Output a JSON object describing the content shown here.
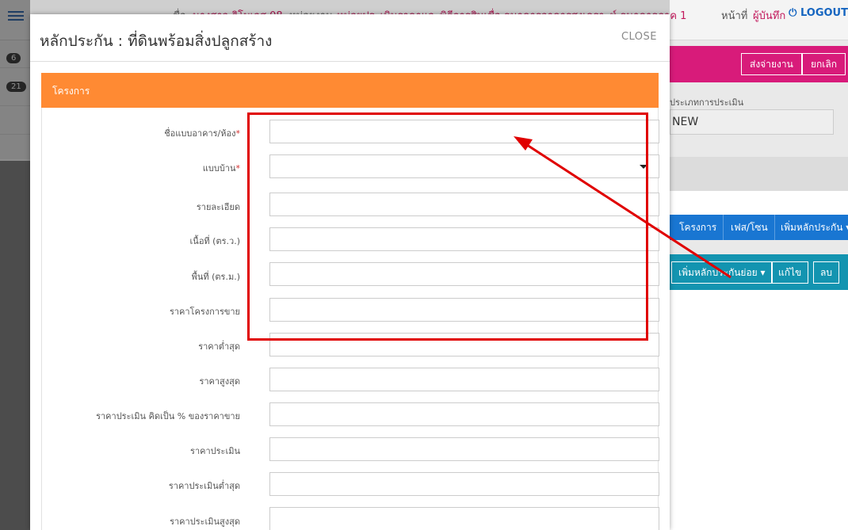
{
  "topbar": {
    "label_name": "ชื่อ",
    "user_name": "นางสาว ธิโมเลส 08",
    "label_unit": "หน่วยงาน",
    "unit_name": "หน่วยประเมินราคาและพิธีการสินเชื่อ ธนาคารอาคารสงเคราะห์ ธนาคารภาค 1",
    "label_page": "หน้าที่",
    "page_name": "ผู้บันทึก",
    "logout": "LOGOUT"
  },
  "sidebar": {
    "badges": [
      "6",
      "21"
    ]
  },
  "background_page": {
    "send_button": "ส่งจ่ายงาน",
    "cancel_button": "ยกเลิก",
    "eval_label": "ประเภทการประเมิน",
    "eval_value": "NEW",
    "tabs": [
      "โครงการ",
      "เฟส/โซน",
      "เพิ่มหลักประกัน"
    ],
    "add_sub_button": "เพิ่มหลักประกันย่อย",
    "edit_button": "แก้ไข",
    "delete_button": "ลบ"
  },
  "modal": {
    "title": "หลักประกัน : ที่ดินพร้อมสิ่งปลูกสร้าง",
    "close_label": "CLOSE",
    "section_title": "โครงการ",
    "fields": [
      {
        "label": "ชื่อแบบอาคาร/ห้อง",
        "required": true,
        "type": "text",
        "value": ""
      },
      {
        "label": "แบบบ้าน",
        "required": true,
        "type": "select",
        "value": ""
      },
      {
        "label": "รายละเอียด",
        "required": false,
        "type": "text",
        "value": ""
      },
      {
        "label": "เนื้อที่ (ตร.ว.)",
        "required": false,
        "type": "text",
        "value": ""
      },
      {
        "label": "พื้นที่ (ตร.ม.)",
        "required": false,
        "type": "text",
        "value": ""
      },
      {
        "label": "ราคาโครงการขาย",
        "required": false,
        "type": "text",
        "value": ""
      },
      {
        "label": "ราคาต่ำสุด",
        "required": false,
        "type": "text",
        "value": ""
      },
      {
        "label": "ราคาสูงสุด",
        "required": false,
        "type": "text",
        "value": ""
      },
      {
        "label": "ราคาประเมิน คิดเป็น % ของราคาขาย",
        "required": false,
        "type": "text",
        "value": ""
      },
      {
        "label": "ราคาประเมิน",
        "required": false,
        "type": "text",
        "value": ""
      },
      {
        "label": "ราคาประเมินต่ำสุด",
        "required": false,
        "type": "text",
        "value": ""
      },
      {
        "label": "ราคาประเมินสูงสุด",
        "required": false,
        "type": "text",
        "value": ""
      }
    ]
  },
  "colors": {
    "section_header": "#ff8a33",
    "highlight": "#e00000",
    "pink_bar": "#d81b7a",
    "tabs_bar": "#1976d2",
    "teal_bar": "#1394b0"
  }
}
